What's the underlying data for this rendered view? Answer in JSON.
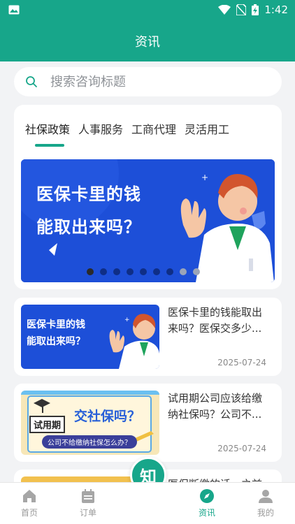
{
  "status_bar": {
    "time": "1:42"
  },
  "header": {
    "title": "资讯"
  },
  "search": {
    "placeholder": "搜索咨询标题"
  },
  "tabs": [
    {
      "label": "社保政策",
      "active": true
    },
    {
      "label": "人事服务",
      "active": false
    },
    {
      "label": "工商代理",
      "active": false
    },
    {
      "label": "灵活用工",
      "active": false
    }
  ],
  "banner": {
    "line1": "医保卡里的钱",
    "line2": "能取出来吗？"
  },
  "articles": [
    {
      "title": "医保卡里的钱能取出来吗？医保交多少...",
      "date": "2025-07-24",
      "thumb_line1": "医保卡里的钱",
      "thumb_line2": "能取出来吗？"
    },
    {
      "title": "试用期公司应该给缴纳社保吗？公司不...",
      "date": "2025-07-24",
      "thumb_tag": "试用期",
      "thumb_big": "交社保吗？",
      "thumb_sub": "公司不给缴纳社保怎么办？"
    },
    {
      "title": "医保断缴的话，之前",
      "date": ""
    }
  ],
  "fab": {
    "label": "知"
  },
  "bottom_nav": [
    {
      "label": "首页",
      "icon": "home-icon"
    },
    {
      "label": "订单",
      "icon": "order-icon"
    },
    {
      "label": "资讯",
      "icon": "compass-icon",
      "active": true
    },
    {
      "label": "我的",
      "icon": "user-icon"
    }
  ],
  "colors": {
    "primary": "#17a68a",
    "banner_blue": "#1d4fd8"
  }
}
